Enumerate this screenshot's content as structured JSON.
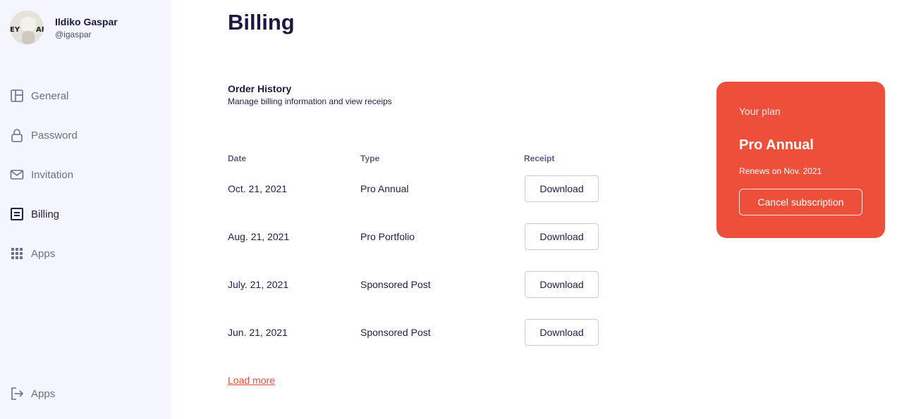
{
  "user": {
    "name": "Ildiko Gaspar",
    "handle": "@igaspar"
  },
  "sidebar": {
    "items": [
      {
        "label": "General",
        "icon": "layout-icon"
      },
      {
        "label": "Password",
        "icon": "lock-icon"
      },
      {
        "label": "Invitation",
        "icon": "mail-icon"
      },
      {
        "label": "Billing",
        "icon": "billing-icon",
        "active": true
      },
      {
        "label": "Apps",
        "icon": "grid-icon"
      }
    ],
    "footer": {
      "label": "Apps",
      "icon": "logout-icon"
    }
  },
  "page": {
    "title": "Billing"
  },
  "order_history": {
    "title": "Order History",
    "subtitle": "Manage billing information and view receips",
    "columns": [
      "Date",
      "Type",
      "Receipt"
    ],
    "rows": [
      {
        "date": "Oct. 21, 2021",
        "type": "Pro Annual",
        "receipt": "Download"
      },
      {
        "date": "Aug. 21, 2021",
        "type": "Pro Portfolio",
        "receipt": "Download"
      },
      {
        "date": "July. 21, 2021",
        "type": "Sponsored Post",
        "receipt": "Download"
      },
      {
        "date": "Jun. 21, 2021",
        "type": "Sponsored Post",
        "receipt": "Download"
      }
    ],
    "load_more": "Load more"
  },
  "plan": {
    "kicker": "Your plan",
    "name": "Pro Annual",
    "renews": "Renews on Nov. 2021",
    "cancel_label": "Cancel subscription"
  },
  "colors": {
    "accent": "#ee4f3a",
    "text": "#1f1d4d",
    "muted": "#6b6d93",
    "sidebar_bg": "#f5f6fd"
  }
}
